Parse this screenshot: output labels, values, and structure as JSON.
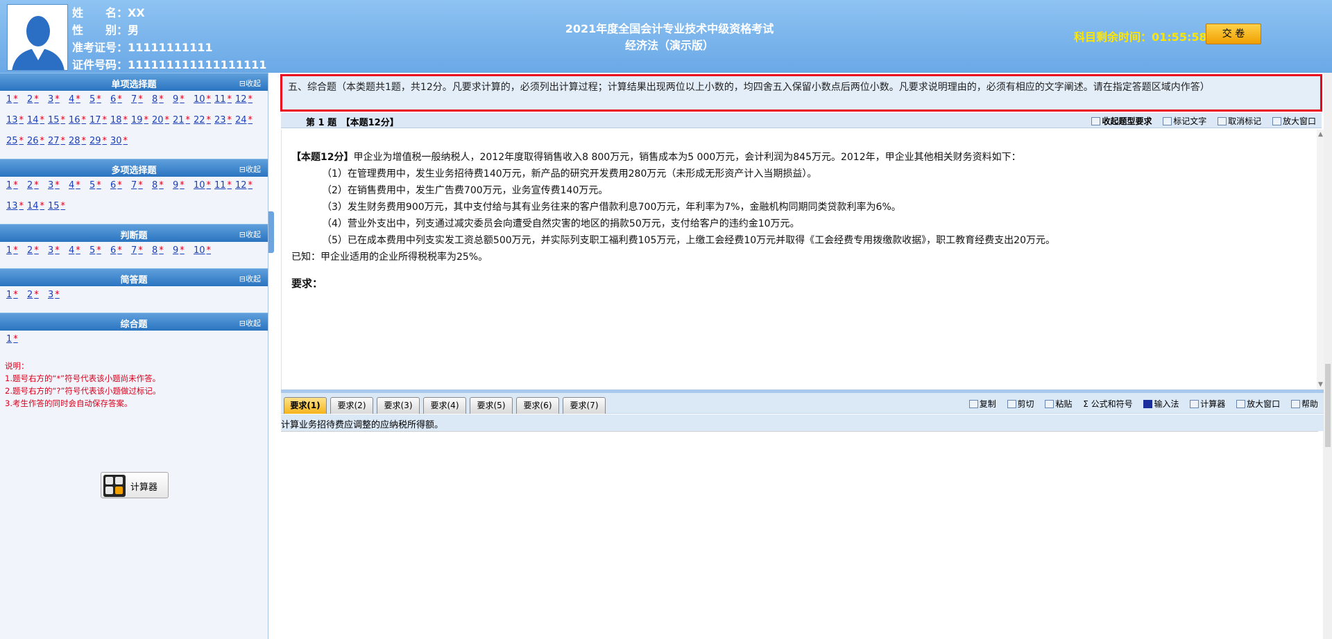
{
  "candidate": {
    "name_label": "姓　　名：",
    "name": "XX",
    "gender_label": "性　　别：",
    "gender": "男",
    "ticket_label": "准考证号：",
    "ticket": "11111111111",
    "id_label": "证件号码：",
    "id": "111111111111111111"
  },
  "exam": {
    "title": "2021年度全国会计专业技术中级资格考试",
    "subject": "经济法（演示版）",
    "timer_label": "科目剩余时间：",
    "timer_value": "01:55:58",
    "submit_label": "交 卷"
  },
  "sections": [
    {
      "title": "单项选择题",
      "collapse": "⊟收起",
      "questions": [
        "1",
        "2",
        "3",
        "4",
        "5",
        "6",
        "7",
        "8",
        "9",
        "10",
        "11",
        "12",
        "13",
        "14",
        "15",
        "16",
        "17",
        "18",
        "19",
        "20",
        "21",
        "22",
        "23",
        "24",
        "25",
        "26",
        "27",
        "28",
        "29",
        "30"
      ]
    },
    {
      "title": "多项选择题",
      "collapse": "⊟收起",
      "questions": [
        "1",
        "2",
        "3",
        "4",
        "5",
        "6",
        "7",
        "8",
        "9",
        "10",
        "11",
        "12",
        "13",
        "14",
        "15"
      ]
    },
    {
      "title": "判断题",
      "collapse": "⊟收起",
      "questions": [
        "1",
        "2",
        "3",
        "4",
        "5",
        "6",
        "7",
        "8",
        "9",
        "10"
      ]
    },
    {
      "title": "简答题",
      "collapse": "⊟收起",
      "questions": [
        "1",
        "2",
        "3"
      ]
    },
    {
      "title": "综合题",
      "collapse": "⊟收起",
      "questions": [
        "1"
      ]
    }
  ],
  "star": "*",
  "notes": {
    "title": "说明：",
    "line1": "1.题号右方的“*”符号代表该小题尚未作答。",
    "line2": "2.题号右方的“?”符号代表该小题做过标记。",
    "line3": "3.考生作答的同时会自动保存答案。"
  },
  "calculator_label": "计算器",
  "instruction": "五、综合题（本类题共1题，共12分。凡要求计算的，必须列出计算过程；计算结果出现两位以上小数的，均四舍五入保留小数点后两位小数。凡要求说明理由的，必须有相应的文字阐述。请在指定答题区域内作答）",
  "question_header": {
    "number": "第 1 题　【本题12分】",
    "tools": {
      "collapse": "收起题型要求",
      "mark": "标记文字",
      "unmark": "取消标记",
      "enlarge": "放大窗口"
    }
  },
  "question": {
    "lead_bold": "【本题12分】",
    "intro": "甲企业为增值税一般纳税人，2012年度取得销售收入8 800万元，销售成本为5 000万元，会计利润为845万元。2012年，甲企业其他相关财务资料如下：",
    "items": [
      "（1）在管理费用中，发生业务招待费140万元，新产品的研究开发费用280万元（未形成无形资产计入当期损益）。",
      "（2）在销售费用中，发生广告费700万元，业务宣传费140万元。",
      "（3）发生财务费用900万元，其中支付给与其有业务往来的客户借款利息700万元，年利率为7%，金融机构同期同类贷款利率为6%。",
      "（4）营业外支出中，列支通过减灾委员会向遭受自然灾害的地区的捐款50万元，支付给客户的违约金10万元。",
      "（5）已在成本费用中列支实发工资总额500万元，并实际列支职工福利费105万元，上缴工会经费10万元并取得《工会经费专用拨缴款收据》，职工教育经费支出20万元。"
    ],
    "known": "已知：甲企业适用的企业所得税税率为25%。",
    "requirement": "要求："
  },
  "req_tabs": [
    "要求(1)",
    "要求(2)",
    "要求(3)",
    "要求(4)",
    "要求(5)",
    "要求(6)",
    "要求(7)"
  ],
  "answer_tools": {
    "copy": "复制",
    "cut": "剪切",
    "paste": "粘贴",
    "formula": "Σ 公式和符号",
    "ime": "输入法",
    "calc": "计算器",
    "enlarge": "放大窗口",
    "help": "帮助"
  },
  "prompt": "计算业务招待费应调整的应纳税所得额。",
  "colors": {
    "header": "#7cb6ec",
    "accent_red": "#e8001c",
    "timer": "#ffe600",
    "submit": "#f6b41c"
  }
}
